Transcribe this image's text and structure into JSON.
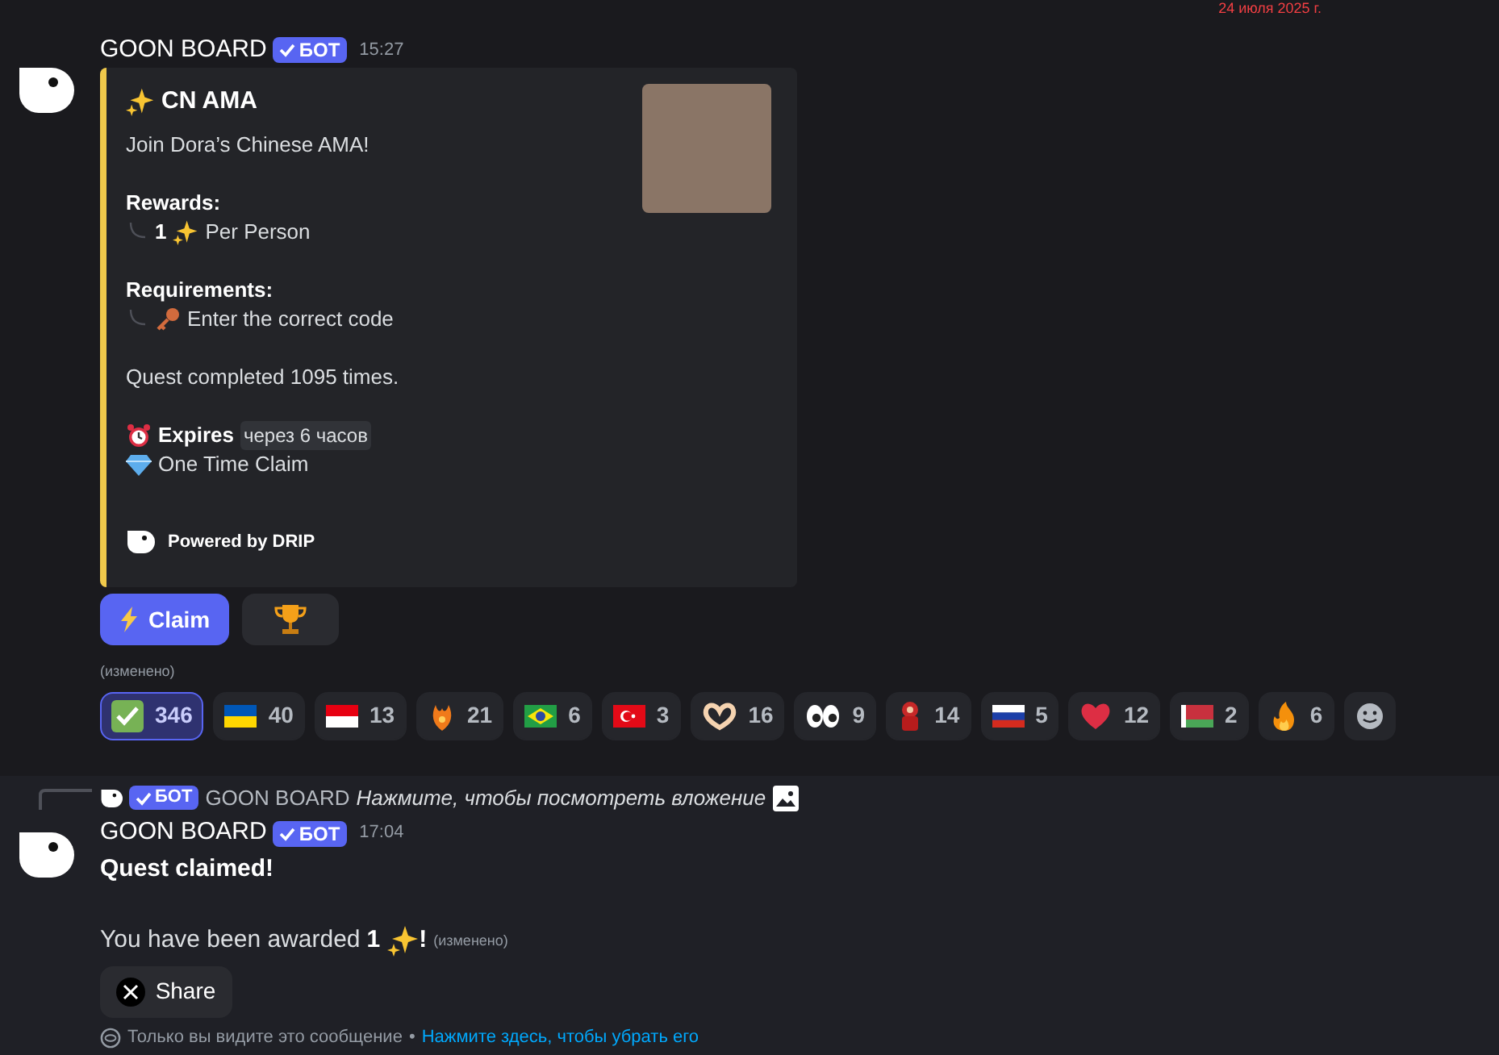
{
  "date_divider": "24 июля 2025 г.",
  "message": {
    "author": "GOON BOARD",
    "badge": "БОТ",
    "time": "15:27",
    "embed": {
      "title": "CN AMA",
      "description": "Join Dora’s Chinese AMA!",
      "rewards_label": "Rewards:",
      "reward_amount": "1",
      "reward_text": "Per Person",
      "requirements_label": "Requirements:",
      "requirement_text": "Enter the correct code",
      "completed": "Quest completed 1095 times.",
      "expires_label": "Expires",
      "expires_value": "через 6 часов",
      "claim_type": "One Time Claim",
      "footer": "Powered by DRIP"
    },
    "buttons": [
      {
        "kind": "claim",
        "label": "Claim"
      },
      {
        "kind": "trophy"
      }
    ],
    "edited": "(изменено)",
    "reactions": [
      {
        "kind": "check",
        "count": "346",
        "selected": true
      },
      {
        "kind": "ukraine",
        "count": "40",
        "selected": false
      },
      {
        "kind": "indonesia",
        "count": "13",
        "selected": false
      },
      {
        "kind": "phoenix",
        "count": "21",
        "selected": false
      },
      {
        "kind": "brazil",
        "count": "6",
        "selected": false
      },
      {
        "kind": "turkey",
        "count": "3",
        "selected": false
      },
      {
        "kind": "hearthands",
        "count": "16",
        "selected": false
      },
      {
        "kind": "eyes",
        "count": "9",
        "selected": false
      },
      {
        "kind": "figure",
        "count": "14",
        "selected": false
      },
      {
        "kind": "russia",
        "count": "5",
        "selected": false
      },
      {
        "kind": "heart",
        "count": "12",
        "selected": false
      },
      {
        "kind": "belarus",
        "count": "2",
        "selected": false
      },
      {
        "kind": "fire",
        "count": "6",
        "selected": false
      }
    ]
  },
  "reply_message": {
    "reply": {
      "badge": "БОТ",
      "author": "GOON BOARD",
      "text": "Нажмите, чтобы посмотреть вложение"
    },
    "author": "GOON BOARD",
    "badge": "БОТ",
    "time": "17:04",
    "title": "Quest claimed!",
    "award_prefix": "You have been awarded",
    "award_amount": "1",
    "award_suffix": "!",
    "edited": "(изменено)",
    "share": "Share",
    "note": "Только вы видите это сообщение",
    "note_separator": "•",
    "dismiss_link": "Нажмите здесь, чтобы убрать его"
  }
}
